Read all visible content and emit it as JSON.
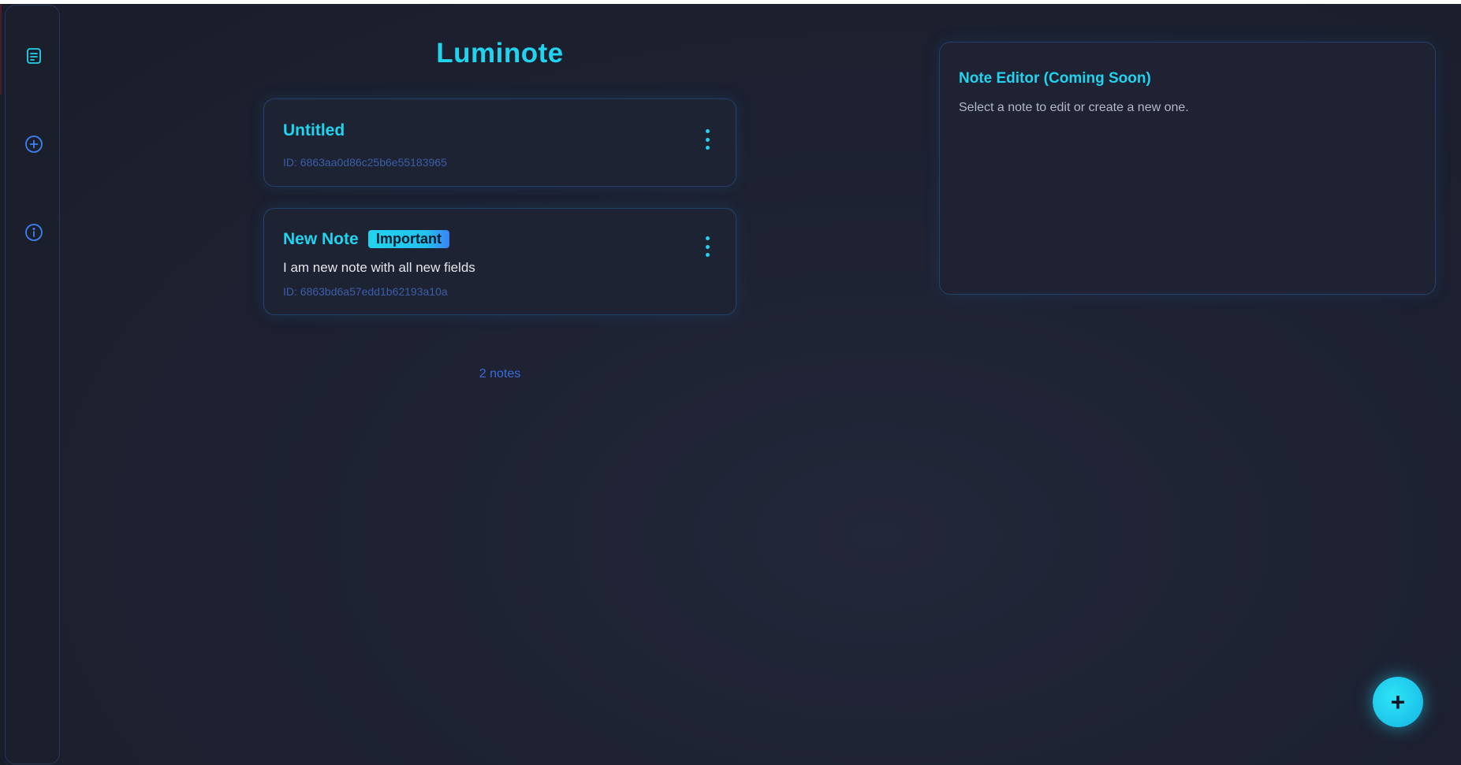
{
  "app": {
    "title": "Luminote"
  },
  "sidebar": {
    "items": [
      {
        "icon": "notes-icon",
        "label": ""
      },
      {
        "icon": "plus-circle-icon",
        "label": ""
      },
      {
        "icon": "info-icon",
        "label": ""
      }
    ]
  },
  "notes": [
    {
      "title": "Untitled",
      "badge": "",
      "body": "",
      "id_text": "ID: 6863aa0d86c25b6e55183965"
    },
    {
      "title": "New Note",
      "badge": "Important",
      "body": "I am new note with all new fields",
      "id_text": "ID: 6863bd6a57edd1b62193a10a"
    }
  ],
  "note_count": "2 notes",
  "editor": {
    "title": "Note Editor (Coming Soon)",
    "placeholder_text": "Select a note to edit or create a new one."
  },
  "fab": {
    "label": "+"
  },
  "colors": {
    "accent": "#22d3ee",
    "secondary": "#3b82f6",
    "background": "#1c2030"
  }
}
